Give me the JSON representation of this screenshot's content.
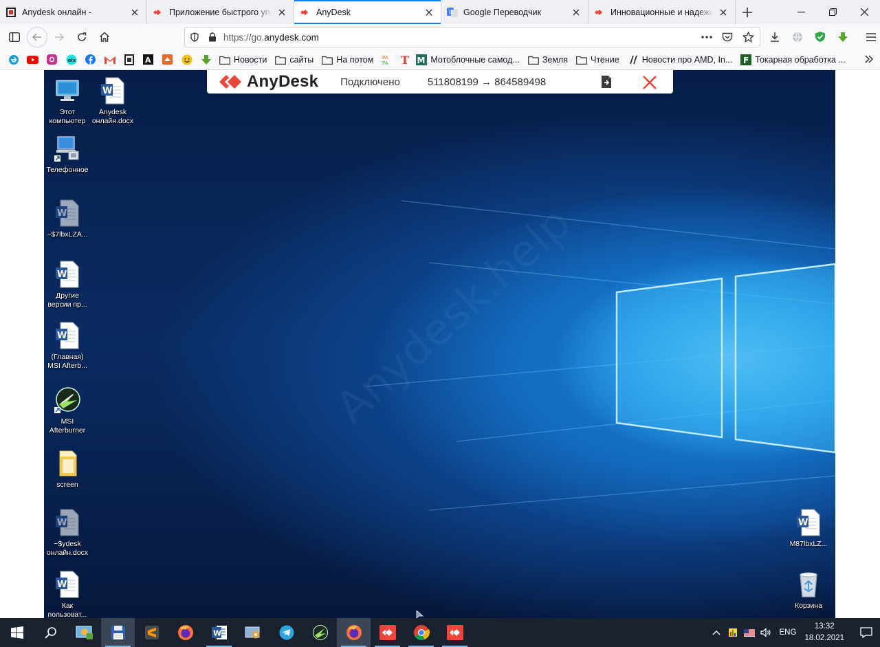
{
  "browser": {
    "tabs": [
      {
        "title": "Anydesk онлайн -",
        "favicon": "anydesk-doc-icon",
        "active": false
      },
      {
        "title": "Приложение быстрого управления",
        "favicon": "anydesk-red-icon",
        "active": false
      },
      {
        "title": "AnyDesk",
        "favicon": "anydesk-red-icon",
        "active": true
      },
      {
        "title": "Google Переводчик",
        "favicon": "google-translate-icon",
        "active": false
      },
      {
        "title": "Инновационные и надежные",
        "favicon": "anydesk-red-icon",
        "active": false
      }
    ],
    "url_prefix": "https://go.",
    "url_domain": "anydesk.com",
    "bookmarks": [
      {
        "label": "Новости"
      },
      {
        "label": "сайты"
      },
      {
        "label": "На потом"
      },
      {
        "label": "Мотоблочные самод..."
      },
      {
        "label": "Земля"
      },
      {
        "label": "Чтение"
      },
      {
        "label": "Новости про AMD, In..."
      },
      {
        "label": "Токарная обработка ..."
      }
    ]
  },
  "anydesk": {
    "logo_text": "AnyDesk",
    "status": "Подключено",
    "connection": "511808199 → 864589498",
    "watermark": "Anydesk.help"
  },
  "desktop": {
    "icons": [
      {
        "label": "Этот\nкомпьютер",
        "icon": "computer-icon"
      },
      {
        "label": "Anydesk\nонлайн.docx",
        "icon": "word-doc-icon"
      },
      {
        "label": "Телефонное",
        "icon": "phone-dialer-icon"
      },
      {
        "label": "~$7lbxLZA...",
        "icon": "word-doc-icon"
      },
      {
        "label": "Другие\nверсии пр...",
        "icon": "word-doc-icon"
      },
      {
        "label": "(Главная)\nMSI Afterb...",
        "icon": "word-doc-icon"
      },
      {
        "label": "MSI\nAfterburner",
        "icon": "msi-afterburner-icon"
      },
      {
        "label": "screen",
        "icon": "folder-icon"
      },
      {
        "label": "~$ydesk\nонлайн.docx",
        "icon": "word-doc-icon"
      },
      {
        "label": "Как\nпользоват...",
        "icon": "word-doc-icon"
      },
      {
        "label": "M87lbxLZ...",
        "icon": "word-doc-icon"
      },
      {
        "label": "Корзина",
        "icon": "recycle-bin-icon"
      }
    ]
  },
  "taskbar": {
    "language": "ENG",
    "time": "13:32",
    "date": "18.02.2021"
  }
}
